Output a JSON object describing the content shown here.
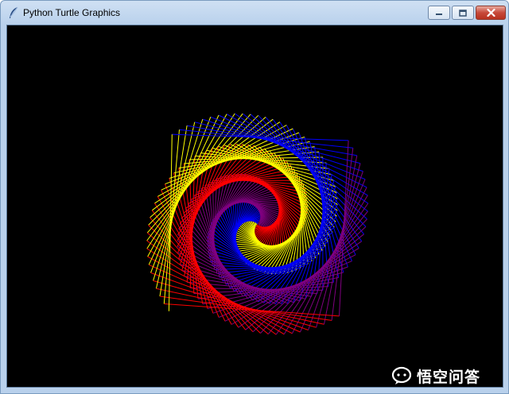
{
  "window": {
    "title": "Python Turtle Graphics",
    "controls": [
      "minimize",
      "maximize",
      "close"
    ]
  },
  "icons": {
    "app": "feather-icon",
    "minimize": "minimize-icon",
    "maximize": "maximize-icon",
    "close": "close-icon",
    "watermark_logo": "speech-bubble-icon"
  },
  "canvas": {
    "background": "#000000",
    "pen_colors": [
      "#ff0000",
      "#800080",
      "#0000ff",
      "#ffff00"
    ]
  },
  "watermark": {
    "text": "悟空问答"
  }
}
